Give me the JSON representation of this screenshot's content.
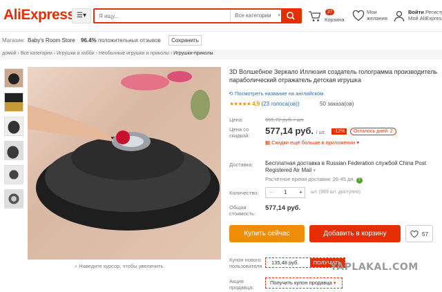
{
  "header": {
    "logo": "AliExpress",
    "search_placeholder": "Я ищу...",
    "category_select": "Все категории",
    "cart_count": "27",
    "cart_label": "Корзина",
    "wishlist_label_1": "Мои",
    "wishlist_label_2": "желания",
    "account_label_1": "Войти",
    "account_label_2": "Регистр.",
    "account_label_3": "Мой AliExpress"
  },
  "store": {
    "label": "Магазин:",
    "name": "Baby's Room Store",
    "rating": "96.4%",
    "rating_text": "положительных отзывов",
    "save_label": "Сохранить"
  },
  "breadcrumb": {
    "home": "домой",
    "items": [
      "Все категории",
      "Игрушки и хобби",
      "Необычные игрушки и приколы"
    ],
    "current": "Игрушки-приколы",
    "separator": "›"
  },
  "gallery": {
    "zoom_hint": "Наведите курсор, чтобы увеличить"
  },
  "product": {
    "title": "3D Волшебное Зеркало Иллюзия создатель голограмма производитель параболический отражатель детская игрушка",
    "translate_link": "Посмотреть название на английском",
    "stars": "★★★★★",
    "rating": "4.9",
    "reviews": "(23 голоса(ов))",
    "orders": "50 заказа(ов)"
  },
  "price": {
    "label": "Цена:",
    "old": "655,72 руб. / шт.",
    "sale_label_1": "Цена со",
    "sale_label_2": "скидкой:",
    "current": "577,14 руб.",
    "unit": "/ шт.",
    "discount": "-12%",
    "remaining": "Осталось дней: 2",
    "app_discount": "Скидки ещё больше в приложении"
  },
  "shipping": {
    "label": "Доставка:",
    "line1": "Бесплатная доставка в Russian Federation службой China Post Registered Air Mail",
    "line2": "Расчётное время доставки: 26-45 дн."
  },
  "quantity": {
    "label": "Количество:",
    "minus": "−",
    "value": "1",
    "plus": "+",
    "note": "шт. (969 шт. доступно)"
  },
  "total": {
    "label_1": "Общая",
    "label_2": "стоимость:",
    "value": "577,14 руб."
  },
  "actions": {
    "buy": "Купить сейчас",
    "cart": "Добавить в корзину",
    "wish_count": "57"
  },
  "coupon": {
    "label_1": "Купон нового",
    "label_2": "пользователя",
    "value": "135,48 руб.",
    "button": "ПОЛУЧИТЬ"
  },
  "promo": {
    "label_1": "Акция",
    "label_2": "продавца:",
    "button": "Получить купон продавца"
  },
  "watermark": "YAPLAKAL.COM",
  "colors": {
    "brand": "#e62e04",
    "buy": "#f08d08",
    "link": "#2b6cb0",
    "star": "#e99800"
  }
}
